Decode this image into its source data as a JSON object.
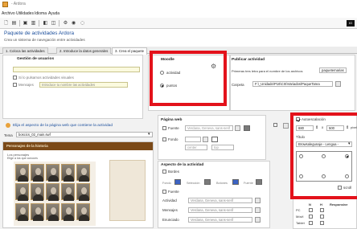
{
  "window": {
    "title": "- Ardora"
  },
  "menu": [
    "Archivo",
    "Utilidades",
    "Idioma",
    "Ayuda"
  ],
  "toolbar": {
    "icons": [
      "new-icon",
      "open-icon",
      "save-icon",
      "save-as-icon",
      "undo-icon",
      "paste-icon",
      "copy-icon",
      "settings-icon",
      "preview-icon",
      "help-icon"
    ],
    "right_label": "IO"
  },
  "header": {
    "title": "Paquete de actividades Ardora",
    "subtitle": "Crea un sistema de navegación entre actividades"
  },
  "tabs": [
    "1. Coloca las actividades",
    "2. Introduce la datos generales",
    "3. Crea el paquete"
  ],
  "users": {
    "title": "Gestión de usuarios",
    "check_label": "Si lo pulsamos actividades visuales",
    "message_label": "Mensajes",
    "message_value": "Introduce tu nombre las actividades"
  },
  "moodle": {
    "title": "Moodle",
    "option1": "actividad",
    "option2": "puntos"
  },
  "publish": {
    "title": "Publicar actividad",
    "name_label": "Primeras tres letra para el nombre de los archivos",
    "name_value": "paquetemarias",
    "folder_label": "Carpeta",
    "folder_value": "F:\\_Unidade\\P16\\CIS\\Variados\\PaqueTarea"
  },
  "aspect": {
    "title": "Elija el aspecto de la página web que contiene la actividad",
    "theme_label": "Tema",
    "theme_value": "boscics_02_main.swf"
  },
  "preview": {
    "heading": "Personajes de la historia",
    "sub": "Los personajes",
    "caption": "Elige a los que conoces"
  },
  "webpage": {
    "title": "Página web",
    "font_label": "Fuente",
    "font_value": "Verdana, Geneva, sans-serif",
    "bg_label": "Fondo",
    "alt1": "center",
    "alt2": "top"
  },
  "activity_aspect": {
    "title": "Aspecto de la actividad",
    "borders_label": "Bordes",
    "color_labels": [
      "Fondo",
      "Selección",
      "Botones",
      "Fuente"
    ],
    "font_check_label": "Fuente",
    "rows": [
      {
        "label": "Actividad",
        "value": "Verdana, Geneva, sans-serif"
      },
      {
        "label": "Mensajes",
        "value": "Verdana, Geneva, sans-serif"
      },
      {
        "label": "Enunciado",
        "value": "Verdana, Geneva, sans-serif"
      }
    ]
  },
  "autoscale": {
    "label": "Autoescalación",
    "width": "680",
    "height": "500",
    "unit": "pixels",
    "title_label": "Título",
    "title_value": "Browsalegunaje - Lengua -",
    "scroll_label": "scroll"
  },
  "responsive": {
    "headers": [
      "N",
      "H",
      "Responsive"
    ],
    "rows": [
      "PC",
      "Móvil",
      "Tablet"
    ]
  },
  "colors": {
    "accent": "#1c4f9c",
    "highlight": "#e3121b",
    "preview_bar": "#7b4a18",
    "swatch_blue": "#3c63c4",
    "swatch_gray": "#7a7a7a"
  }
}
